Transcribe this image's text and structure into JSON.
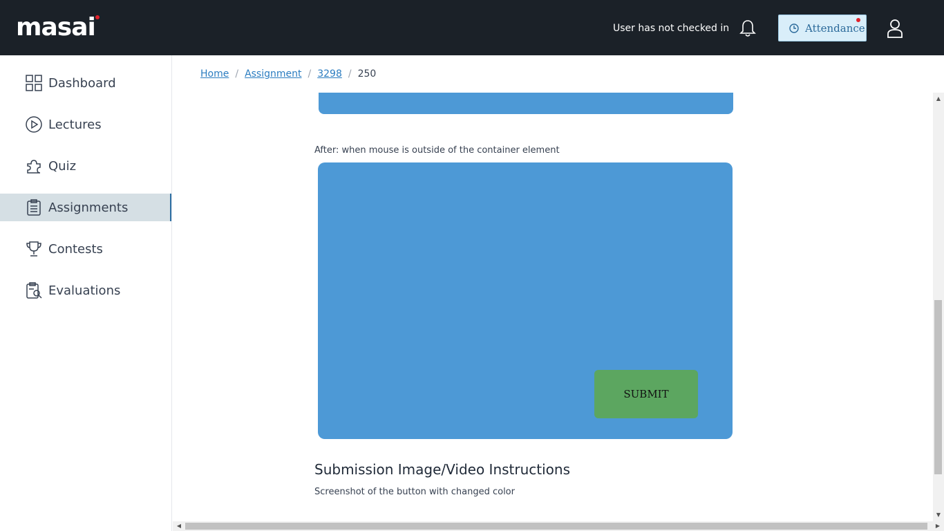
{
  "header": {
    "logo_text": "masai",
    "checkin_status": "User has not checked in",
    "attendance_label": "Attendance",
    "bell_icon": "bell-icon",
    "user_icon": "user-icon",
    "accent_color": "#e0202a"
  },
  "sidebar": {
    "items": [
      {
        "label": "Dashboard",
        "icon": "dashboard-grid-icon",
        "active": false
      },
      {
        "label": "Lectures",
        "icon": "play-circle-icon",
        "active": false
      },
      {
        "label": "Quiz",
        "icon": "puzzle-icon",
        "active": false
      },
      {
        "label": "Assignments",
        "icon": "clipboard-icon",
        "active": true
      },
      {
        "label": "Contests",
        "icon": "trophy-icon",
        "active": false
      },
      {
        "label": "Evaluations",
        "icon": "evaluation-icon",
        "active": false
      }
    ]
  },
  "breadcrumb": {
    "items": [
      "Home",
      "Assignment",
      "3298"
    ],
    "current": "250",
    "separator": "/"
  },
  "content": {
    "caption": "After: when mouse is outside of the container element",
    "submit_label": "SUBMIT",
    "section_title": "Submission Image/Video Instructions",
    "instruction": "Screenshot of the button with changed color",
    "demo_color": "#4d99d6",
    "submit_color": "#5ca660"
  }
}
